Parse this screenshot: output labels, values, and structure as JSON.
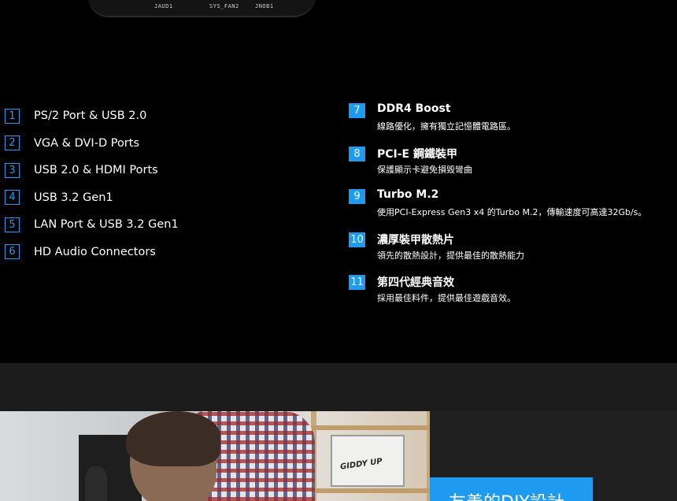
{
  "board": {
    "silkscreen": [
      "JAUD1",
      "SYS_FAN2",
      "JNOB1"
    ]
  },
  "left_items": [
    {
      "num": "1",
      "label": "PS/2 Port & USB 2.0"
    },
    {
      "num": "2",
      "label": "VGA & DVI-D Ports"
    },
    {
      "num": "3",
      "label": "USB 2.0 & HDMI Ports"
    },
    {
      "num": "4",
      "label": "USB 3.2 Gen1"
    },
    {
      "num": "5",
      "label": "LAN Port & USB 3.2 Gen1"
    },
    {
      "num": "6",
      "label": "HD Audio Connectors"
    }
  ],
  "right_items": [
    {
      "num": "7",
      "title": "DDR4 Boost",
      "desc": "線路優化，擁有獨立記憶體電路區。"
    },
    {
      "num": "8",
      "title": "PCI-E 鋼鐵裝甲",
      "desc": "保護顯示卡避免損毀彎曲"
    },
    {
      "num": "9",
      "title": "Turbo M.2",
      "desc": "使用PCI-Express Gen3 x4 的Turbo M.2，傳輸速度可高達32Gb/s。"
    },
    {
      "num": "10",
      "title": "濃厚裝甲散熱片",
      "desc": "領先的散熱設計，提供最佳的散熱能力"
    },
    {
      "num": "11",
      "title": "第四代經典音效",
      "desc": "採用最佳料件，提供最佳遊戲音效。"
    }
  ],
  "photo": {
    "poster_text": "GIDDY UP"
  },
  "diy": {
    "title": "友善的DIY設計"
  },
  "colors": {
    "accent": "#1e9bf0",
    "background": "#000000",
    "band": "#1c1c1c"
  }
}
